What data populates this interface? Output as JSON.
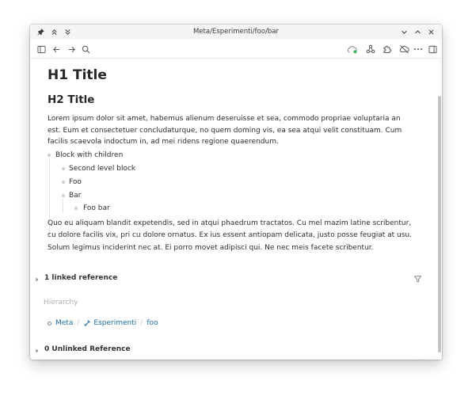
{
  "window": {
    "title": "Meta/Esperimenti/foo/bar"
  },
  "titlebar": {
    "left_icons": [
      "pin-icon",
      "chevron-double-up-icon",
      "chevron-double-down-icon"
    ],
    "right_icons": [
      "chevron-down-icon",
      "chevron-up-icon",
      "close-icon"
    ]
  },
  "toolbar": {
    "left_icons": [
      "sidebar-toggle-icon",
      "arrow-left-icon",
      "arrow-right-icon",
      "search-icon"
    ],
    "right_icons": [
      "cloud-sync-icon",
      "graph-icon",
      "puzzle-icon",
      "cloud-off-icon",
      "more-icon",
      "right-sidebar-icon"
    ],
    "sync_color": "#3cb55e"
  },
  "page": {
    "h1": "H1 Title",
    "h2": "H2 Title",
    "para1": "Lorem ipsum dolor sit amet, habemus alienum deseruisse et sea, commodo propriae voluptaria an est. Eum et consectetuer concludaturque, no quem doming vis, ea sea atqui velit constituam. Cum facilis scaevola indoctum in, ad mei ridens regione quaerendum.",
    "blocks": {
      "b1": "Block with children",
      "b2": "Second level block",
      "b3": "Foo",
      "b4": "Bar",
      "b5": "Foo bar"
    },
    "para2": "Quo eu aliquam blandit expetendis, sed in atqui phaedrum tractatos. Cu mel mazim latine scribentur, cu dolore facilis vix, pri cu dolore ornatus. Ex ius essent antiopam delicata, justo posse feugiat at usu.",
    "para3": "Solum legimus inciderint nec at. Ei porro movet adipisci qui. Ne nec meis facete scribentur."
  },
  "references": {
    "linked": "1 linked reference",
    "unlinked": "0 Unlinked Reference"
  },
  "hierarchy": {
    "label": "Hierarchy",
    "crumbs": [
      "Meta",
      "Esperimenti",
      "foo"
    ],
    "separator": "/"
  },
  "help": {
    "label": "?"
  },
  "colors": {
    "link": "#1e6ea7",
    "accent_green": "#3cb55e"
  }
}
